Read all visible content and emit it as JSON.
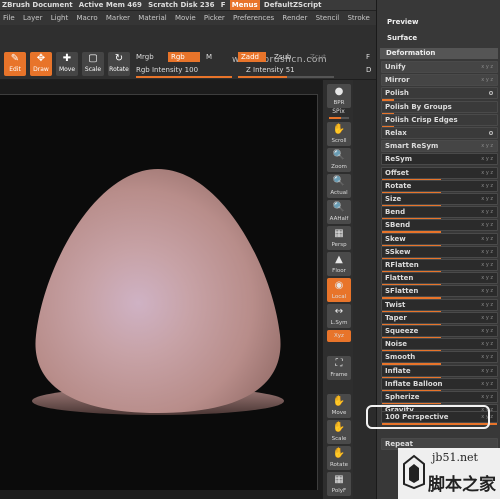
{
  "titlebar": {
    "items": [
      "ZBrush Document",
      "Active Mem 469",
      "Scratch Disk 236",
      "F",
      "Menus",
      "DefaultZScript"
    ]
  },
  "menubar": {
    "items": [
      "File",
      "Layer",
      "Light",
      "Macro",
      "Marker",
      "Material",
      "Movie",
      "Picker",
      "Preferences",
      "Render",
      "Stencil",
      "Stroke"
    ]
  },
  "watermark_top": "www.zbrushcn.com",
  "shelf": {
    "tools": [
      {
        "label": "Edit",
        "icon": "pencil-square-icon",
        "active": true
      },
      {
        "label": "Draw",
        "icon": "crosshair-icon",
        "active": true
      },
      {
        "label": "Move",
        "icon": "move-icon",
        "active": false
      },
      {
        "label": "Scale",
        "icon": "scale-icon",
        "active": false
      },
      {
        "label": "Rotate",
        "icon": "rotate-icon",
        "active": false
      }
    ],
    "mrgb": "Mrgb",
    "rgb": "Rgb",
    "m": "M",
    "zadd": "Zadd",
    "zsub": "Zsub",
    "zcut": "Zcut",
    "rgb_intensity": "Rgb Intensity 100",
    "z_intensity": "Z Intensity 51",
    "focal_label": "F",
    "draw_label": "D"
  },
  "right_column": {
    "bpr": "BPR",
    "spix": "SPix",
    "scroll": "Scroll",
    "zoom": "Zoom",
    "actual": "Actual",
    "aahalf": "AAHalf",
    "persp": "Persp",
    "floor": "Floor",
    "local": "Local",
    "lsym": "L.Sym",
    "xyz": "Xyz",
    "frame": "Frame",
    "move": "Move",
    "scale": "Scale",
    "rotate": "Rotate",
    "polyf": "PolyF"
  },
  "palette": {
    "preview": "Preview",
    "surface": "Surface",
    "header": "Deformation",
    "rows": [
      {
        "label": "Unify",
        "xyz": "x y z",
        "bar": 0.0
      },
      {
        "label": "Mirror",
        "xyz": "x y z",
        "bar": 0.0
      },
      {
        "label": "Polish",
        "xyz": "",
        "bar": 0.1
      },
      {
        "label": "Polish By Groups",
        "xyz": "",
        "bar": 0.1
      },
      {
        "label": "Polish Crisp Edges",
        "xyz": "",
        "bar": 0.1
      },
      {
        "label": "Relax",
        "xyz": "",
        "bar": 0.0
      },
      {
        "label": "Smart ReSym",
        "xyz": "x y z",
        "bar": 0.0
      },
      {
        "label": "ReSym",
        "xyz": "x y z",
        "bar": 0.0
      },
      {
        "label": "Offset",
        "xyz": "x y z",
        "bar": 0.5
      },
      {
        "label": "Rotate",
        "xyz": "x y z",
        "bar": 0.5
      },
      {
        "label": "Size",
        "xyz": "x y z",
        "bar": 0.5
      },
      {
        "label": "Bend",
        "xyz": "x y z",
        "bar": 0.5
      },
      {
        "label": "SBend",
        "xyz": "x y z",
        "bar": 0.5
      },
      {
        "label": "Skew",
        "xyz": "x y z",
        "bar": 0.5
      },
      {
        "label": "SSkew",
        "xyz": "x y z",
        "bar": 0.5
      },
      {
        "label": "RFlatten",
        "xyz": "x y z",
        "bar": 0.5
      },
      {
        "label": "Flatten",
        "xyz": "x y z",
        "bar": 0.5
      },
      {
        "label": "SFlatten",
        "xyz": "x y z",
        "bar": 0.5
      },
      {
        "label": "Twist",
        "xyz": "x y z",
        "bar": 0.5
      },
      {
        "label": "Taper",
        "xyz": "x y z",
        "bar": 0.5
      },
      {
        "label": "Squeeze",
        "xyz": "x y z",
        "bar": 0.5
      },
      {
        "label": "Noise",
        "xyz": "x y z",
        "bar": 0.5
      },
      {
        "label": "Smooth",
        "xyz": "x y z",
        "bar": 0.5
      },
      {
        "label": "Inflate",
        "xyz": "x y z",
        "bar": 0.5
      },
      {
        "label": "Inflate Balloon",
        "xyz": "x y z",
        "bar": 0.5
      },
      {
        "label": "Spherize",
        "xyz": "x y z",
        "bar": 0.5
      },
      {
        "label": "Gravity",
        "xyz": "x y z",
        "bar": 0.5
      }
    ],
    "perspective": {
      "value": "100",
      "label": "Perspective",
      "xyz": "x y z"
    },
    "repeat": "Repeat"
  },
  "watermark": {
    "url": "jb51.net",
    "cn": "脚本之家"
  },
  "colors": {
    "accent": "#e8742a",
    "panel": "#383838",
    "viewport": "#0b0b0b",
    "egg": "#c49a9a"
  }
}
